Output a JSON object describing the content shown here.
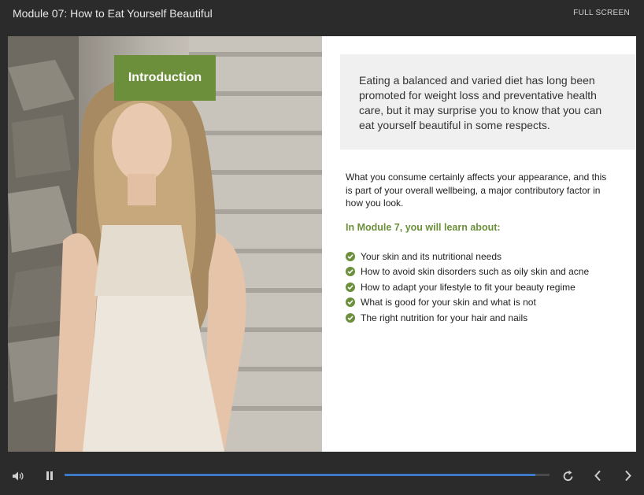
{
  "header": {
    "title": "Module 07: How to Eat Yourself Beautiful",
    "fullscreen_label": "FULL SCREEN"
  },
  "slide": {
    "badge_label": "Introduction",
    "quote": "Eating a balanced and varied diet has long been promoted for weight loss and preventative health care, but it may surprise you to know that you can eat yourself beautiful in some respects.",
    "body": "What you consume certainly affects your appearance, and this is part of your overall wellbeing, a major contributory factor in how you look.",
    "learn_heading": "In Module 7, you will learn about:",
    "learn_items": [
      "Your skin and its nutritional needs",
      "How to avoid skin disorders such as oily skin and acne",
      "How to adapt your lifestyle to fit your beauty regime",
      "What is good for your skin and what is not",
      "The right nutrition for your hair and nails"
    ]
  },
  "player": {
    "progress": 0.97,
    "icons": [
      "volume-icon",
      "pause-icon",
      "replay-icon",
      "previous-icon",
      "next-icon"
    ]
  },
  "colors": {
    "accent_green": "#6b8f3a",
    "progress_blue": "#3d79c7",
    "chrome": "#2b2b2b"
  }
}
